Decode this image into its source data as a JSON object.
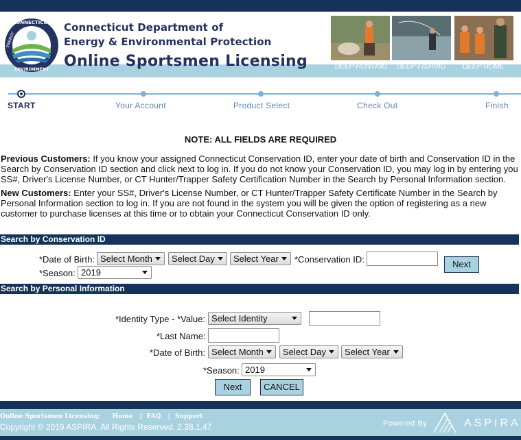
{
  "header": {
    "dept_line1": "Connecticut Department of",
    "dept_line2": "Energy & Environmental Protection",
    "app_title": "Online Sportsmen Licensing",
    "logo_text_top": "CONNECTICUT",
    "logo_text_left": "ENERGY",
    "logo_text_bottom": "ENVIRONMENT",
    "photo_links": [
      {
        "label": "DEEP-HUNTING",
        "icon": "hunting-photo"
      },
      {
        "label": "DEEP-FISHING",
        "icon": "fishing-photo"
      },
      {
        "label": "DEEP-HOME",
        "icon": "home-photo"
      }
    ]
  },
  "steps": [
    {
      "label": "START",
      "active": true
    },
    {
      "label": "Your Account",
      "active": false
    },
    {
      "label": "Product Select",
      "active": false
    },
    {
      "label": "Check Out",
      "active": false
    },
    {
      "label": "Finish",
      "active": false
    }
  ],
  "note": "NOTE: ALL FIELDS ARE REQUIRED",
  "previous_customers": {
    "heading": "Previous Customers:",
    "text": " If you know your assigned Connecticut Conservation ID, enter your date of birth and Conservation ID in the Search by Conservation ID section and click next to log in. If you do not know your Conservation ID, you may log in by entering you SS#, Driver's License Number, or CT Hunter/Trapper Safety Certification Number in the Search by Personal Information section."
  },
  "new_customers": {
    "heading": "New Customers:",
    "text": " Enter your SS#, Driver's License Number, or CT Hunter/Trapper Safety Certificate Number in the Search by Personal Information section to log in. If you are not found in the system you will be given the option of registering as a new customer to purchase licenses at this time or to obtain your Connecticut Conservation ID only."
  },
  "search_cid": {
    "title": "Search by Conservation ID",
    "dob_label": "*Date of Birth:",
    "month": "Select Month",
    "day": "Select Day",
    "year": "Select Year",
    "cid_label": "*Conservation ID:",
    "cid_value": "",
    "next_label": "Next",
    "season_label": "*Season:",
    "season": "2019"
  },
  "search_pi": {
    "title": "Search by Personal Information",
    "identity_label": "*Identity Type - *Value:",
    "identity": "Select Identity",
    "identity_value": "",
    "last_name_label": "*Last Name:",
    "last_name_value": "",
    "dob_label": "*Date of Birth:",
    "month": "Select Month",
    "day": "Select Day",
    "year": "Select Year",
    "season_label": "*Season:",
    "season": "2019",
    "next_label": "Next",
    "cancel_label": "CANCEL"
  },
  "footer": {
    "app_name": "Online Sportsmen Licensing:",
    "links": [
      "Home",
      "FAQ",
      "Support"
    ],
    "separator": "|",
    "copyright": "Copyright © 2019 ASPIRA. All Rights Reserved.  2.38.1.47",
    "powered_by": "Powered By",
    "brand": "ASPIRA"
  },
  "colors": {
    "navy": "#15335a",
    "light_blue": "#a9d2e0",
    "step_blue": "#7ab3d6",
    "title_navy": "#23325e"
  }
}
